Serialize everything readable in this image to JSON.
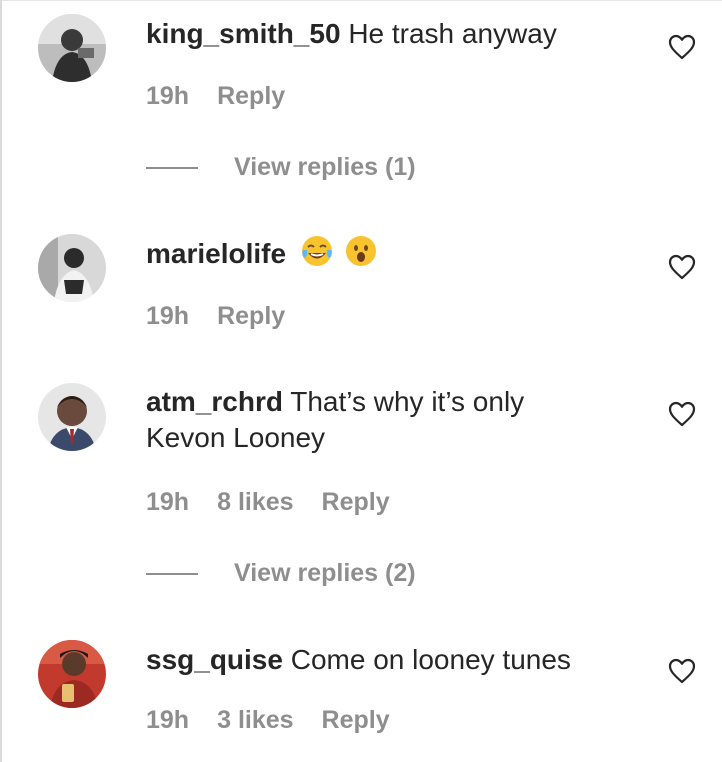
{
  "comments": [
    {
      "username": "king_smith_50",
      "text": "He trash anyway",
      "time": "19h",
      "likes": "",
      "reply_label": "Reply",
      "view_replies": "View replies (1)",
      "avatar_colors": [
        "#3a3a3a",
        "#cfcfcf"
      ]
    },
    {
      "username": "marielolife",
      "text": "",
      "emojis": [
        "face-with-tears-of-joy",
        "face-with-open-mouth"
      ],
      "time": "19h",
      "likes": "",
      "reply_label": "Reply",
      "view_replies": "",
      "avatar_colors": [
        "#2b2b2b",
        "#e8e8e8"
      ]
    },
    {
      "username": "atm_rchrd",
      "text": "That’s why it’s only Kevon Looney",
      "time": "19h",
      "likes": "8 likes",
      "reply_label": "Reply",
      "view_replies": "View replies (2)",
      "avatar_colors": [
        "#4a3a36",
        "#f0f0f0"
      ]
    },
    {
      "username": "ssg_quise",
      "text": "Come on looney tunes",
      "time": "19h",
      "likes": "3 likes",
      "reply_label": "Reply",
      "view_replies": "",
      "avatar_colors": [
        "#b8302a",
        "#5a3b2a"
      ]
    }
  ],
  "colors": {
    "text": "#262626",
    "meta": "#8e8e8e",
    "emoji": "#f9c330"
  }
}
